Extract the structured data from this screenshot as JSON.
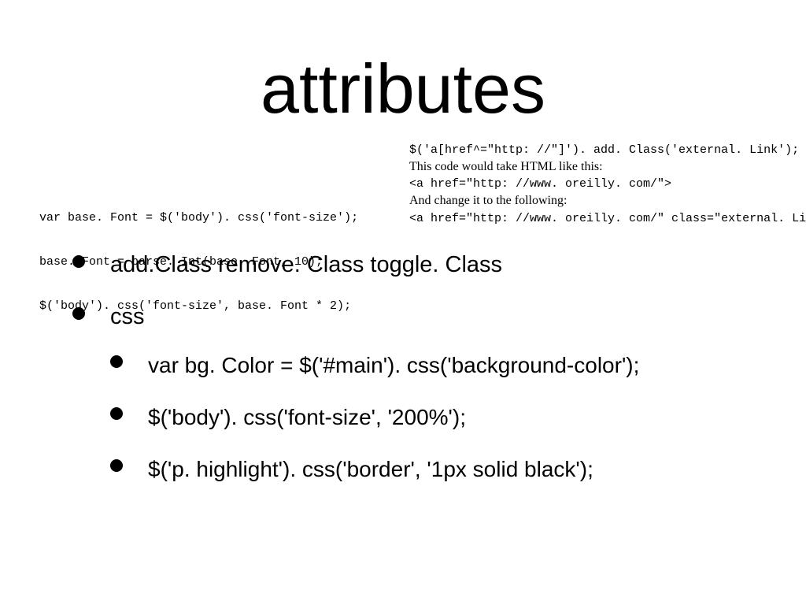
{
  "title": "attributes",
  "code_left": {
    "line1": "var base. Font = $('body'). css('font-size');",
    "line2": "base. Font = parse. Int(base. Font, 10);",
    "line3": "$('body'). css('font-size', base. Font * 2);"
  },
  "code_right": {
    "line1": "$('a[href^=\"http: //\"]'). add. Class('external. Link');",
    "line2": "This code would take HTML like this:",
    "line3": "<a href=\"http: //www. oreilly. com/\">",
    "line4": "And change it to the following:",
    "line5": "<a href=\"http: //www. oreilly. com/\" class=\"external. Link\">"
  },
  "bullets": {
    "item1": "add.Class remove. Class toggle. Class",
    "item2": "css",
    "sub1": " var bg. Color = $('#main'). css('background-color');",
    "sub2": "$('body'). css('font-size', '200%');",
    "sub3": "$('p. highlight'). css('border', '1px solid black');"
  }
}
